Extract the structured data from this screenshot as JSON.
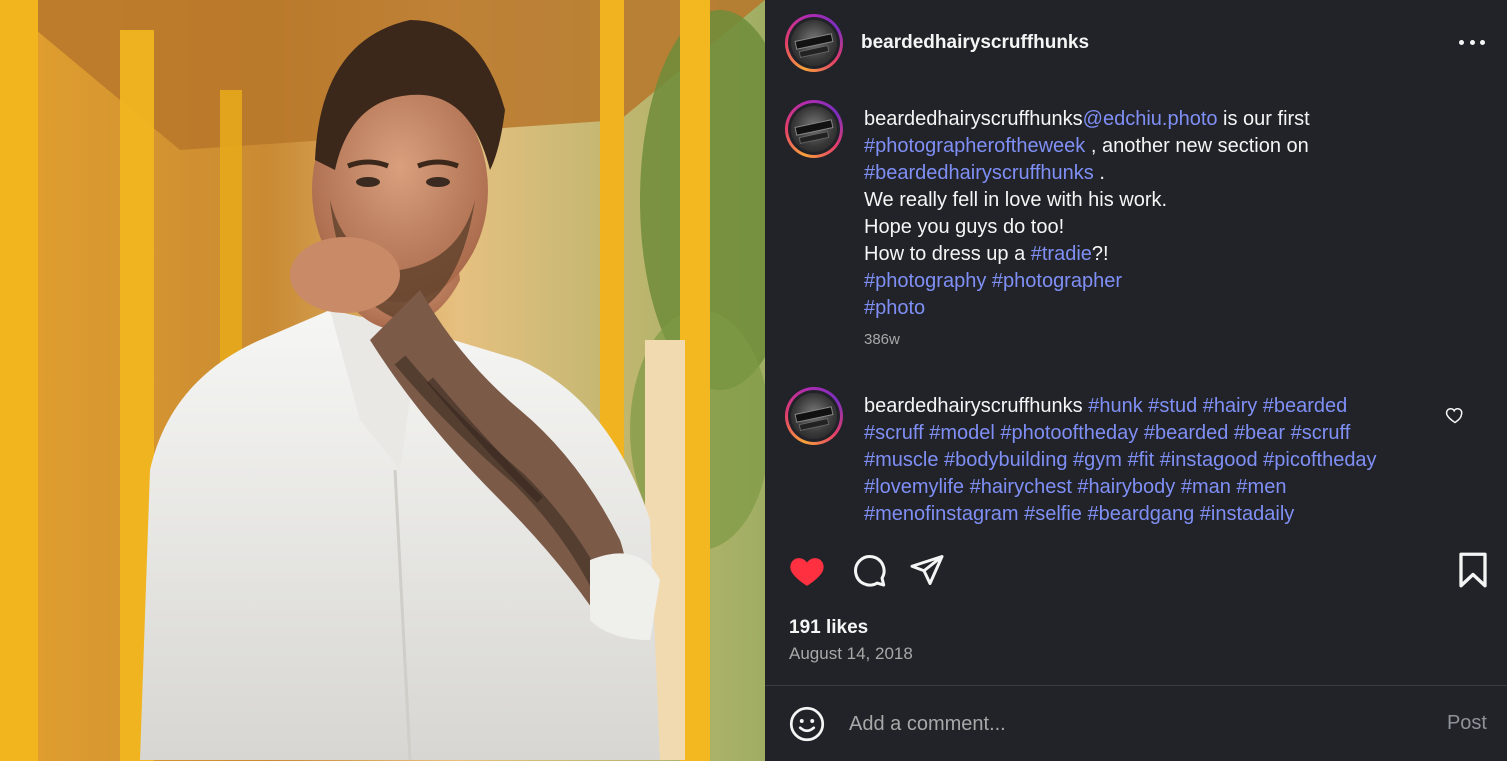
{
  "post": {
    "username": "beardedhairyscruffhunks",
    "caption": {
      "username": "beardedhairyscruffhunks",
      "mention": "@edchiu.photo",
      "text1": " is our first ",
      "tag1": "#photographeroftheweek",
      "text2": " , another new section on ",
      "tag2": "#beardedhairyscruffhunks",
      "text3": " .",
      "line4": "We really fell in love with his work.",
      "line5": "Hope you guys do too!",
      "line6_prefix": "How to dress up a ",
      "tag3": "#tradie",
      "line6_suffix": "?!",
      "tag4": "#photography",
      "tag5": "#photographer",
      "tag6": "#photo",
      "time": "386w"
    },
    "comment2": {
      "username": "beardedhairyscruffhunks",
      "hashtags_line1": "#hunk #stud #hairy #bearded",
      "hashtags_line2": "#scruff #model #photooftheday #bearded #bear #scruff",
      "hashtags_line3": "#muscle #bodybuilding #gym #fit #instagood #picoftheday",
      "hashtags_line4": "#lovemylife #hairychest #hairybody #man #men",
      "hashtags_line5": "#menofinstagram #selfie #beardgang #instadaily"
    },
    "likes": "191 likes",
    "date": "August 14, 2018",
    "comment_placeholder": "Add a comment...",
    "post_label": "Post",
    "icons": {
      "like": "heart-filled-icon",
      "comment": "comment-icon",
      "share": "paper-plane-icon",
      "save": "bookmark-icon",
      "emoji": "emoji-icon",
      "more": "more-icon"
    },
    "colors": {
      "panel_bg": "#212328",
      "link": "#7f8ff5",
      "like_red": "#ff3040",
      "muted": "#a8a8a8"
    }
  }
}
